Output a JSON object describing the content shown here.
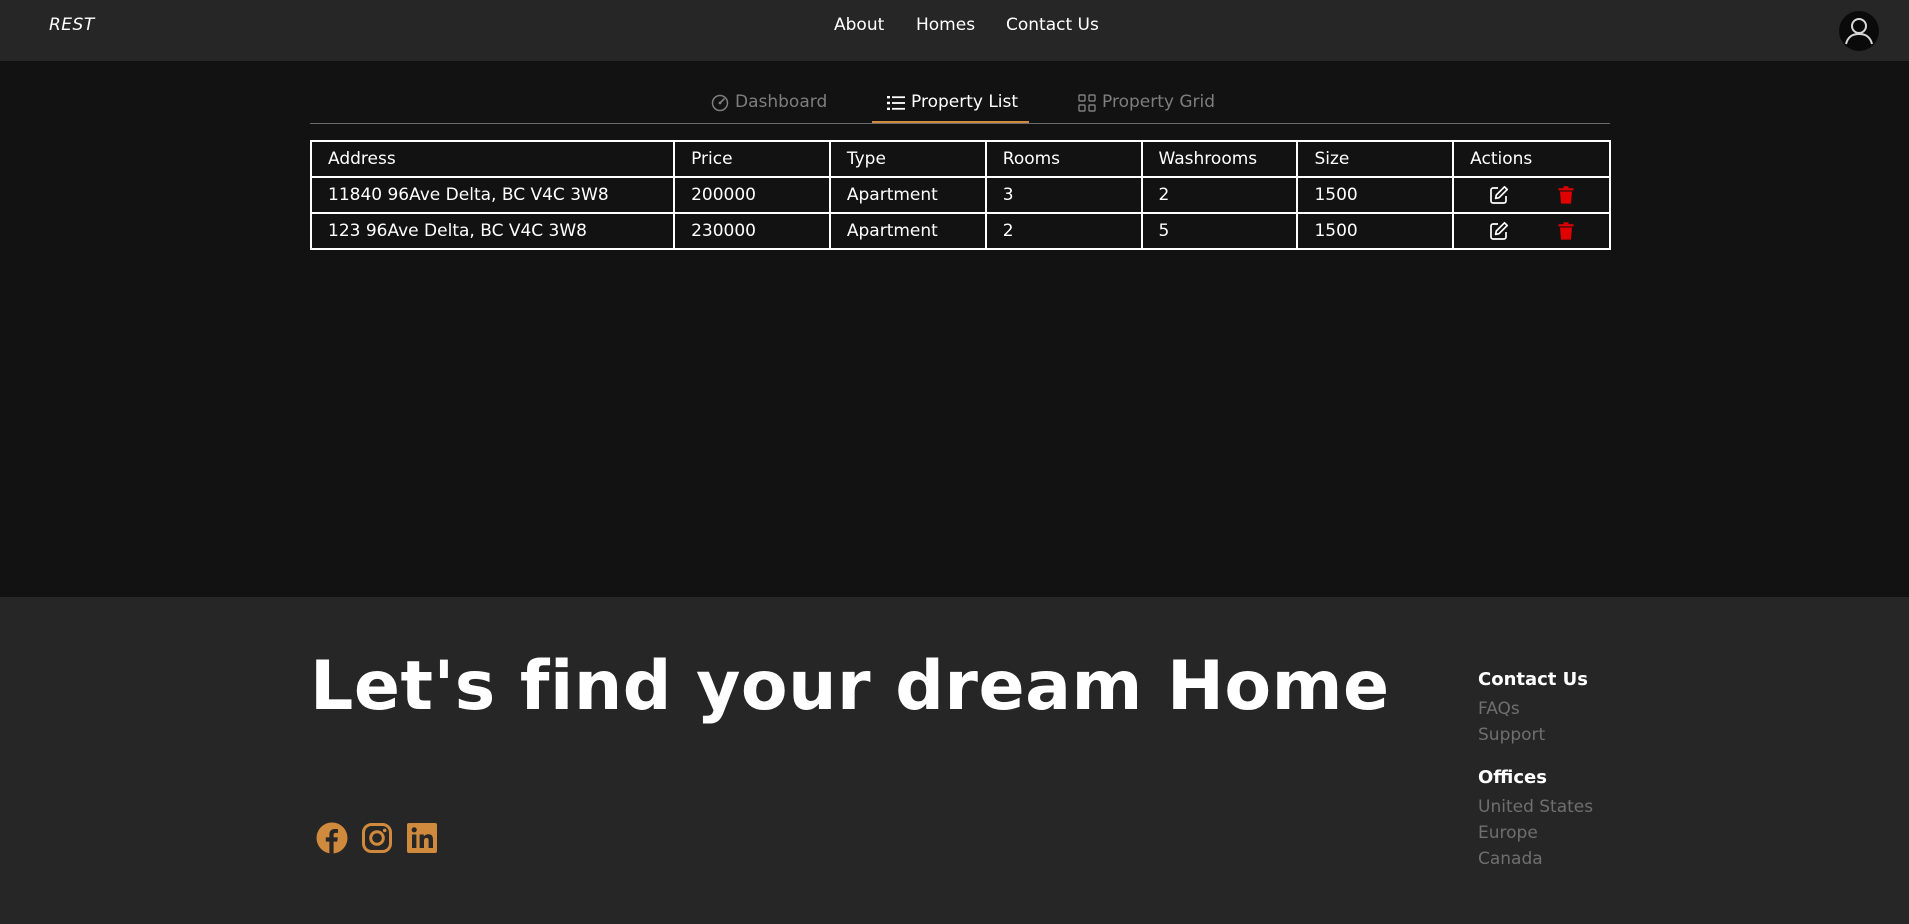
{
  "header": {
    "brand": "REST",
    "nav": [
      "About",
      "Homes",
      "Contact Us"
    ],
    "avatar_icon": "user-avatar-icon"
  },
  "tabs": [
    {
      "label": "Dashboard",
      "icon": "speedometer-icon",
      "active": false
    },
    {
      "label": "Property List",
      "icon": "list-icon",
      "active": true
    },
    {
      "label": "Property Grid",
      "icon": "grid-icon",
      "active": false
    }
  ],
  "table": {
    "columns": [
      "Address",
      "Price",
      "Type",
      "Rooms",
      "Washrooms",
      "Size",
      "Actions"
    ],
    "rows": [
      {
        "address": "11840 96Ave Delta, BC V4C 3W8",
        "price": "200000",
        "type": "Apartment",
        "rooms": "3",
        "washrooms": "2",
        "size": "1500"
      },
      {
        "address": "123 96Ave Delta, BC V4C 3W8",
        "price": "230000",
        "type": "Apartment",
        "rooms": "2",
        "washrooms": "5",
        "size": "1500"
      }
    ]
  },
  "footer": {
    "tagline": "Let's find your dream Home",
    "social": [
      "facebook-icon",
      "instagram-icon",
      "linkedin-icon"
    ],
    "contact_heading": "Contact Us",
    "contact_links": [
      "FAQs",
      "Support"
    ],
    "offices_heading": "Offices",
    "offices_links": [
      "United States",
      "Europe",
      "Canada"
    ]
  },
  "colors": {
    "accent": "#d08a3d",
    "delete": "#e00000",
    "background": "#121212",
    "bar": "#262626"
  }
}
